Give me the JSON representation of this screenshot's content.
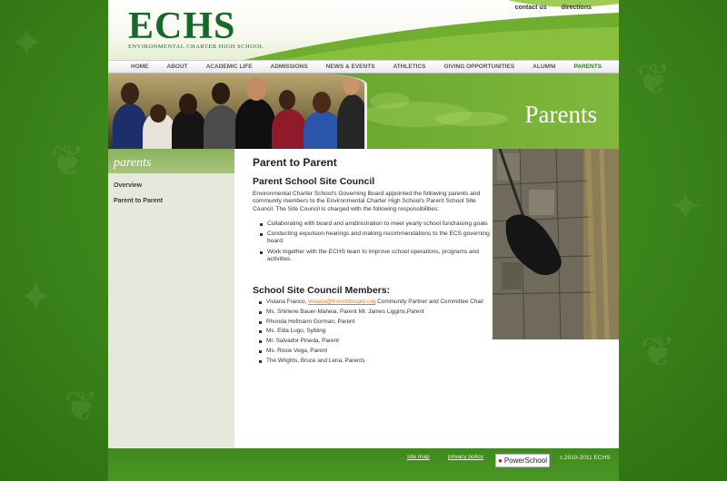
{
  "header": {
    "logo_text": "ECHS",
    "logo_subtitle": "ENVIRONMENTAL CHARTER HIGH SCHOOL",
    "top_links": [
      "contact us",
      "directions"
    ]
  },
  "nav": {
    "items": [
      "HOME",
      "ABOUT",
      "ACADEMIC LIFE",
      "ADMISSIONS",
      "NEWS & EVENTS",
      "ATHLETICS",
      "GIVING OPPORTUNITIES",
      "ALUMNI",
      "PARENTS"
    ],
    "active_color": "#2f7d1a"
  },
  "banner": {
    "title": "Parents"
  },
  "sidebar": {
    "header": "parents",
    "items": [
      "Overview",
      "Parent to Parent"
    ]
  },
  "content": {
    "title": "Parent to Parent",
    "council_heading": "Parent School Site Council",
    "intro": "Environmental Charter School's Governing Board appointed the following parents and community members to the Environmental Charter High School's Parent School Site Council.  The Site Council is charged with the following responsibilities:",
    "responsibilities": [
      "Collaborating with board and amdinistration to meet yearly school fundraising goals",
      "Conducting expulsion hearings and making recommendations to the ECS governing board.",
      "Work together with the ECHS team to improve school operations, programs and activities."
    ],
    "members_heading": "School Site Council Members:",
    "member_first_prefix": "Viviana Franco, ",
    "member_first_email": "viviana@fromlottospot.org",
    "member_first_suffix": " Community Partner and Committee Chair",
    "members": [
      "Ms. Shirlene Bauer-Maheia, Parent Mr. James Liggins,Parent",
      "Rhonda Hofmann Gorman, Parent",
      "Ms. Elda Lugo,  Sybling",
      "Mr. Salvador Pineda, Parent",
      "Ms. Rosie Vega, Parent",
      "The Wrights, Bruce and Lena, Parents"
    ]
  },
  "footer": {
    "site_map": "site map",
    "privacy_policy": "privacy policy",
    "powerschool": "PowerSchool",
    "copyright": "c.2010-2011 ECHS"
  }
}
